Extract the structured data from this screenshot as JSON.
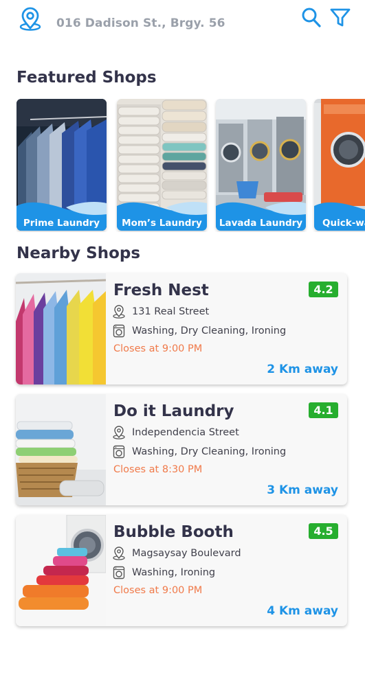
{
  "colors": {
    "accent": "#1e93e6",
    "rating_badge": "#27ae2f",
    "closing_time": "#f07a4a",
    "address_gray": "#9aa0aa",
    "heading": "#33334a"
  },
  "header": {
    "location_icon": "location-pin-icon",
    "address": "016 Dadison St., Brgy. 56",
    "search_icon": "search-icon",
    "filter_icon": "filter-funnel-icon"
  },
  "featured": {
    "title": "Featured Shops",
    "shops": [
      {
        "name": "Prime Laundry"
      },
      {
        "name": "Mom’s Laundry"
      },
      {
        "name": "Lavada Laundry"
      },
      {
        "name": "Quick-wa"
      }
    ]
  },
  "nearby": {
    "title": "Nearby Shops",
    "shops": [
      {
        "name": "Fresh Nest",
        "rating": "4.2",
        "address": "131 Real Street",
        "services": "Washing, Dry Cleaning, Ironing",
        "closes": "Closes at 9:00 PM",
        "distance": "2 Km away"
      },
      {
        "name": "Do it Laundry",
        "rating": "4.1",
        "address": "Independencia Street",
        "services": "Washing, Dry Cleaning, Ironing",
        "closes": "Closes at 8:30 PM",
        "distance": "3 Km away"
      },
      {
        "name": "Bubble Booth",
        "rating": "4.5",
        "address": "Magsaysay Boulevard",
        "services": "Washing, Ironing",
        "closes": "Closes at 9:00 PM",
        "distance": "4 Km away"
      }
    ]
  }
}
